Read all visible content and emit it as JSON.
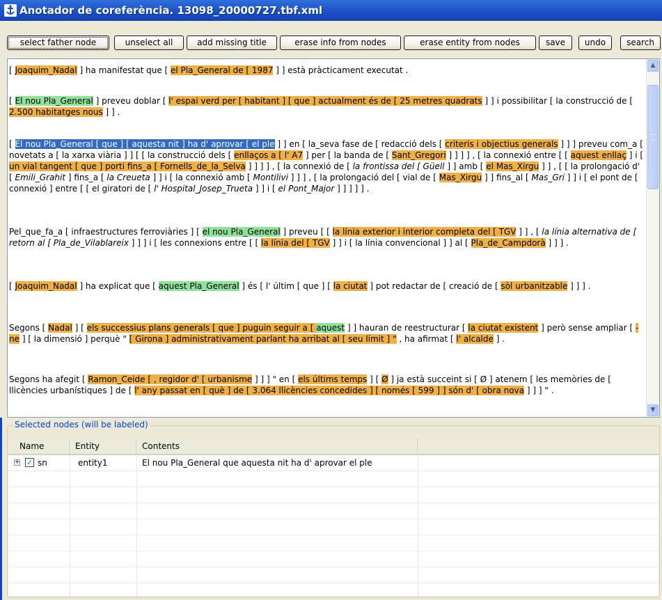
{
  "window": {
    "title": "Anotador de coreferència. 13098_20000727.tbf.xml"
  },
  "toolbar": {
    "buttons": [
      {
        "label": "select father node"
      },
      {
        "label": "unselect all"
      },
      {
        "label": "add missing title"
      },
      {
        "label": "erase info from nodes"
      },
      {
        "label": "erase entity from nodes"
      },
      {
        "label": "save"
      },
      {
        "label": "undo"
      },
      {
        "label": "search"
      }
    ]
  },
  "text": {
    "paragraphs": [
      [
        [
          "n",
          "[ "
        ],
        [
          "o",
          "Joaquim_Nadal"
        ],
        [
          "n",
          " ] ha manifestat que [ "
        ],
        [
          "o",
          "el Pla_General de [ 1987"
        ],
        [
          "n",
          " ] ] està pràcticament executat ."
        ]
      ],
      [
        [
          "n",
          "[ "
        ],
        [
          "g",
          "El nou Pla_General"
        ],
        [
          "n",
          " ] preveu doblar [ "
        ],
        [
          "o",
          "l' espai verd per [ habitant ] [ que ] actualment és de [ 25 metres quadrats"
        ],
        [
          "n",
          " ] ] i possibilitar [ la construcció de [ "
        ],
        [
          "o",
          "2.500 habitatges nous"
        ],
        [
          "n",
          " ] ] ."
        ]
      ],
      [
        [
          "n",
          "[ "
        ],
        [
          "s",
          "El nou Pla_General [ que ] [ aquesta nit ] ha d' aprovar [ el ple"
        ],
        [
          "n",
          " ] ] en [ la_seva fase de [ redacció dels [ "
        ],
        [
          "o",
          "criteris i objectius generals"
        ],
        [
          "n",
          " ] ] ] preveu com_a [ novetats a [ la xarxa viària ] ] [ [ la construcció dels [ "
        ],
        [
          "o",
          "enllaços a [ l' A7"
        ],
        [
          "n",
          " ] per [ la banda de [ "
        ],
        [
          "o",
          "Sant_Gregori"
        ],
        [
          "n",
          " ] ] ] ] , [ la connexió entre [ [ "
        ],
        [
          "o",
          "aquest enllaç"
        ],
        [
          "n",
          " ] i [ "
        ],
        [
          "o",
          "un vial tangent [ que ] porti fins_a [ Fornells_de_la_Selva"
        ],
        [
          "n",
          " ] ] ] ] , [ la connexió de [ "
        ],
        [
          "i",
          "la frontissa del [ Güell"
        ],
        [
          "n",
          " ] ] amb [ "
        ],
        [
          "o",
          "el Mas_Xirgu"
        ],
        [
          "n",
          " ] ] , [ [ la prolongació d' [ "
        ],
        [
          "i",
          "Emili_Grahit"
        ],
        [
          "n",
          " ] fins_a [ "
        ],
        [
          "i",
          "la Creueta"
        ],
        [
          "n",
          " ] ] i [ la connexió amb [ "
        ],
        [
          "i",
          "Montilivi"
        ],
        [
          "n",
          " ] ] ] , [ la prolongació del [ vial de [ "
        ],
        [
          "o",
          "Mas_Xirgu"
        ],
        [
          "n",
          " ] ] fins_al [ "
        ],
        [
          "i",
          "Mas_Gri"
        ],
        [
          "n",
          " ] ] i [ el pont de [ connexió ] entre [ [ el giratori de [ "
        ],
        [
          "i",
          "l' Hospital_Josep_Trueta"
        ],
        [
          "n",
          " ] ] i [ "
        ],
        [
          "i",
          "el Pont_Major"
        ],
        [
          "n",
          " ] ] ] ] ] ."
        ]
      ],
      [
        [
          "n",
          "Pel_que_fa_a [ infraestructures ferroviàries ] [ "
        ],
        [
          "g",
          "el nou Pla_General"
        ],
        [
          "n",
          " ] preveu [ [ "
        ],
        [
          "o",
          "la línia exterior i interior completa del [ TGV"
        ],
        [
          "n",
          " ] ] , [ "
        ],
        [
          "i",
          "la línia alternativa de [ retorn al [ Pla_de_Vilablareix"
        ],
        [
          "n",
          " ] ] ] i [ les connexions entre [ [ "
        ],
        [
          "o",
          "la línia del [ TGV"
        ],
        [
          "n",
          " ] ] i [ la línia convencional ] ] al [ "
        ],
        [
          "o",
          "Pla_de_Campdorà"
        ],
        [
          "n",
          " ] ] ] ."
        ]
      ],
      [
        [
          "n",
          "[ "
        ],
        [
          "o",
          "Joaquim_Nadal"
        ],
        [
          "n",
          " ] ha explicat que [ "
        ],
        [
          "g",
          "aquest Pla_General"
        ],
        [
          "n",
          " ] és [ l' últim [ que ] [ "
        ],
        [
          "o",
          "la ciutat"
        ],
        [
          "n",
          " ] pot redactar de [ creació de [ "
        ],
        [
          "o",
          "sòl urbanitzable"
        ],
        [
          "n",
          " ] ] ] ."
        ]
      ],
      [
        [
          "n",
          "Segons [ "
        ],
        [
          "o",
          "Nadal"
        ],
        [
          "n",
          " ] [ "
        ],
        [
          "o",
          "els successius plans generals [ que ] puguin seguir a [ "
        ],
        [
          "g",
          "aquest"
        ],
        [
          "n",
          " ] ] hauran de reestructurar [ "
        ],
        [
          "o",
          "la ciutat existent"
        ],
        [
          "n",
          " ] però sense ampliar [ "
        ],
        [
          "o",
          "-ne"
        ],
        [
          "n",
          " ] [ la dimensió ] perquè \" "
        ],
        [
          "o",
          "[ Girona ] administrativament parlant ha arribat al [ seu límit ] \""
        ],
        [
          "n",
          " , ha afirmat [ "
        ],
        [
          "o",
          "l' alcalde"
        ],
        [
          "n",
          " ] ."
        ]
      ],
      [
        [
          "n",
          "Segons ha afegit [ "
        ],
        [
          "o",
          "Ramon_Ceide [ , regidor d' [ urbanisme"
        ],
        [
          "n",
          " ] ] ] \" en [ "
        ],
        [
          "o",
          "els últims temps"
        ],
        [
          "n",
          " ] [ "
        ],
        [
          "o",
          "Ø"
        ],
        [
          "n",
          " ] ja està succeint si [ Ø ] atenem [ les memòries de [ llicències urbanístiques ] de [ "
        ],
        [
          "o",
          "l' any passat en [ què ] de [ 3.064 llicències concedides ] [ només [ 599 ] ] són d' [ obra nova"
        ],
        [
          "n",
          " ] ] ] \" ."
        ]
      ]
    ]
  },
  "selected_nodes": {
    "legend": "Selected nodes (will be labeled)",
    "columns": [
      "Name",
      "Entity",
      "Contents"
    ],
    "rows": [
      {
        "expander": "+",
        "checked": "✓",
        "name": "sn",
        "entity": "entity1",
        "contents": "El nou Pla_General que aquesta nit ha d' aprovar el ple"
      }
    ]
  },
  "colors": {
    "coreference_orange": "#f0b042",
    "coreference_green": "#8ee39a",
    "selection_blue": "#316ac5"
  }
}
